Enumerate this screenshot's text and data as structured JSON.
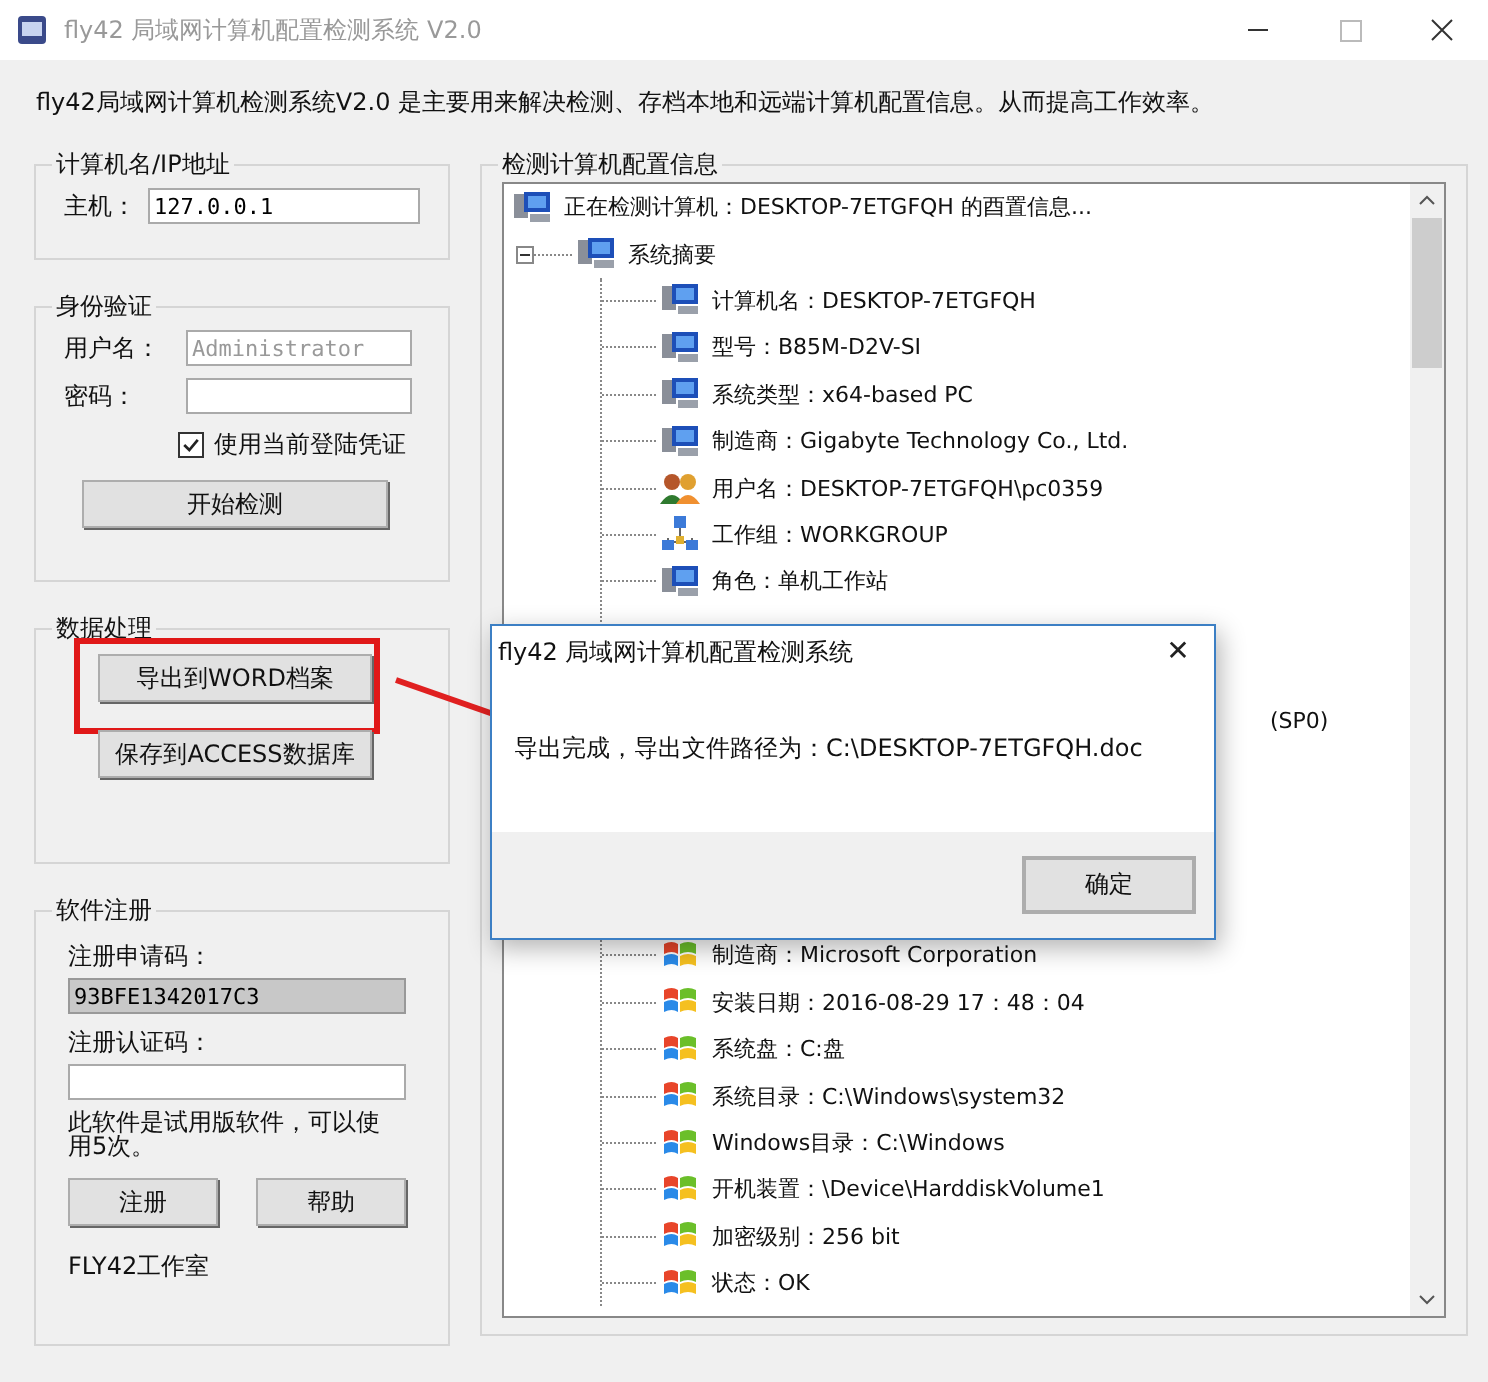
{
  "window": {
    "title": "fly42 局域网计算机配置检测系统 V2.0"
  },
  "description": "fly42局域网计算机检测系统V2.0 是主要用来解决检测、存档本地和远端计算机配置信息。从而提高工作效率。",
  "host_group": {
    "title": "计算机名/IP地址",
    "label": "主机：",
    "value": "127.0.0.1"
  },
  "auth_group": {
    "title": "身份验证",
    "username_label": "用户名：",
    "username_value": "Administrator",
    "username_disabled": true,
    "password_label": "密码：",
    "use_current": {
      "label": "使用当前登陆凭证",
      "checked": true
    },
    "button": "开始检测"
  },
  "data_group": {
    "title": "数据处理",
    "buttons": [
      {
        "label": "导出到WORD档案",
        "highlighted": true
      },
      {
        "label": "保存到ACCESS数据库",
        "highlighted": false
      }
    ]
  },
  "register_group": {
    "title": "软件注册",
    "request_label": "注册申请码：",
    "request_code": "93BFE1342017C3",
    "auth_label": "注册认证码：",
    "notice": "此软件是试用版软件，可以使用5次。",
    "buttons": [
      "注册",
      "帮助"
    ],
    "footer": "FLY42工作室"
  },
  "info_group": {
    "title": "检测计算机配置信息",
    "tree": {
      "label": "正在检测计算机：DESKTOP-7ETGFQH 的酉置信息...",
      "kind": "computer",
      "children": [
        {
          "label": "系统摘要",
          "kind": "computer",
          "expanded": true,
          "children": [
            {
              "kind": "computer",
              "label": "计算机名：DESKTOP-7ETGFQH"
            },
            {
              "kind": "computer",
              "label": "型号：B85M-D2V-SI"
            },
            {
              "kind": "computer",
              "label": "系统类型：x64-based PC"
            },
            {
              "kind": "computer",
              "label": "制造商：Gigabyte Technology Co., Ltd."
            },
            {
              "kind": "users",
              "label": "用户名：DESKTOP-7ETGFQH\\pc0359"
            },
            {
              "kind": "network",
              "label": "工作组：WORKGROUP"
            },
            {
              "kind": "computer",
              "label": "角色：单机工作站"
            },
            {
              "kind": "covered"
            },
            {
              "kind": "covered"
            },
            {
              "kind": "covered",
              "tail": "(SP0)"
            },
            {
              "kind": "covered"
            },
            {
              "kind": "covered"
            },
            {
              "kind": "covered"
            },
            {
              "kind": "covered"
            },
            {
              "kind": "windows",
              "label": "制造商：Microsoft Corporation"
            },
            {
              "kind": "windows",
              "label": "安装日期：2016-08-29 17：48：04"
            },
            {
              "kind": "windows",
              "label": "系统盘：C:盘"
            },
            {
              "kind": "windows",
              "label": "系统目录：C:\\Windows\\system32"
            },
            {
              "kind": "windows",
              "label": "Windows目录：C:\\Windows"
            },
            {
              "kind": "windows",
              "label": "开机装置：\\Device\\HarddiskVolume1"
            },
            {
              "kind": "windows",
              "label": "加密级别：256 bit"
            },
            {
              "kind": "windows",
              "label": "状态：OK"
            }
          ]
        }
      ]
    }
  },
  "dialog": {
    "title": "fly42 局域网计算机配置检测系统",
    "close": "✕",
    "message": "导出完成，导出文件路径为：C:\\DESKTOP-7ETGFQH.doc",
    "button": "确定"
  }
}
